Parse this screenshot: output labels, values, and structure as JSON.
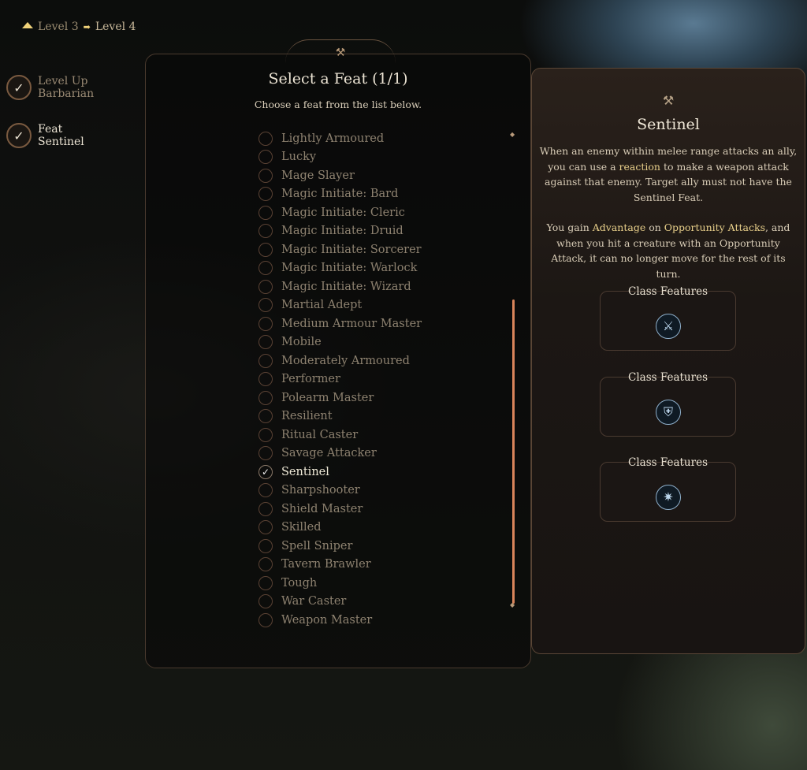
{
  "breadcrumb": {
    "from": "Level 3",
    "to": "Level 4"
  },
  "steps": [
    {
      "line1": "Level Up",
      "line2": "Barbarian"
    },
    {
      "line1": "Feat",
      "line2": "Sentinel"
    }
  ],
  "feat_panel": {
    "title": "Select a Feat (1/1)",
    "subtitle": "Choose a feat from the list below.",
    "feats": [
      "Lightly Armoured",
      "Lucky",
      "Mage Slayer",
      "Magic Initiate: Bard",
      "Magic Initiate: Cleric",
      "Magic Initiate: Druid",
      "Magic Initiate: Sorcerer",
      "Magic Initiate: Warlock",
      "Magic Initiate: Wizard",
      "Martial Adept",
      "Medium Armour Master",
      "Mobile",
      "Moderately Armoured",
      "Performer",
      "Polearm Master",
      "Resilient",
      "Ritual Caster",
      "Savage Attacker",
      "Sentinel",
      "Sharpshooter",
      "Shield Master",
      "Skilled",
      "Spell Sniper",
      "Tavern Brawler",
      "Tough",
      "War Caster",
      "Weapon Master"
    ],
    "selected": "Sentinel"
  },
  "detail": {
    "title": "Sentinel",
    "p1": {
      "a": "When an enemy within melee range attacks an ally, you can use a ",
      "b": "reaction",
      "c": " to make a weapon attack against that enemy. Target ally must not have the Sentinel Feat."
    },
    "p2": {
      "a": "You gain ",
      "b": "Advantage",
      "c": " on ",
      "d": "Opportunity Attacks",
      ".e": "",
      "e": ", and when you hit a creature with an Opportunity Attack, it can no longer move for the rest of its turn."
    },
    "features": [
      {
        "label": "Class Features",
        "icon": "sword-crest-icon"
      },
      {
        "label": "Class Features",
        "icon": "shield-crest-icon"
      },
      {
        "label": "Class Features",
        "icon": "spiked-crest-icon"
      }
    ]
  },
  "colors": {
    "accent": "#e8cf8a",
    "scrollbar": "#d9845a"
  }
}
